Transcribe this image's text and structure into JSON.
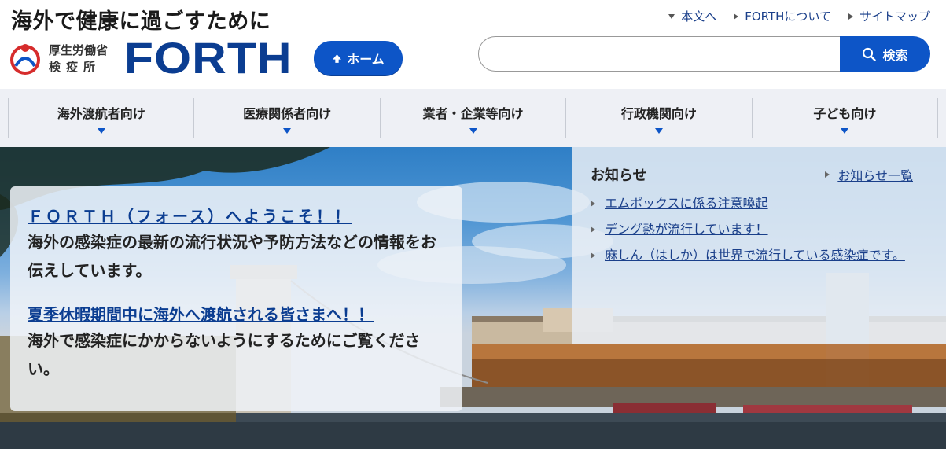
{
  "header": {
    "tagline": "海外で健康に過ごすために",
    "ministry_line1": "厚生労働省",
    "ministry_line2": "検疫所",
    "brand": "FORTH",
    "home_label": "ホーム",
    "util_links": [
      "本文へ",
      "FORTHについて",
      "サイトマップ"
    ],
    "search_placeholder": "",
    "search_label": "検索"
  },
  "nav": {
    "items": [
      "海外渡航者向け",
      "医療関係者向け",
      "業者・企業等向け",
      "行政機関向け",
      "子ども向け"
    ]
  },
  "hero": {
    "welcome_title": "ＦＯＲＴＨ（フォース）へようこそ！！",
    "welcome_text": "海外の感染症の最新の流行状況や予防方法などの情報をお伝えしています。",
    "summer_title": "夏季休暇期間中に海外へ渡航される皆さまへ！！",
    "summer_text": "海外で感染症にかからないようにするためにご覧ください。"
  },
  "news": {
    "title": "お知らせ",
    "all_label": "お知らせ一覧",
    "items": [
      "エムポックスに係る注意喚起",
      "デング熱が流行しています！",
      "麻しん（はしか）は世界で流行している感染症です。"
    ]
  },
  "colors": {
    "brand_blue": "#0b3d91",
    "button_blue": "#0d55c7",
    "nav_bg": "#eef0f5"
  }
}
